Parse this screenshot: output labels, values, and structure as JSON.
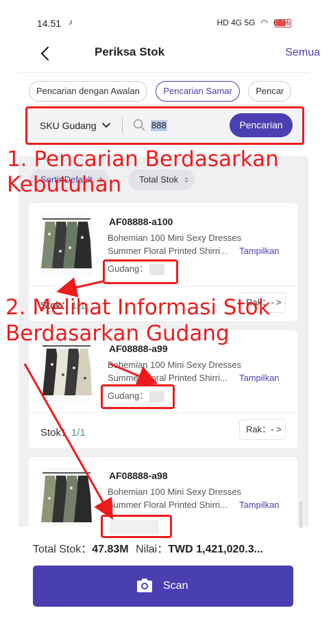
{
  "status_bar": {
    "time": "14.51",
    "network": "HD 4G 5G",
    "battery": "63%",
    "battery_level": 0.63
  },
  "header": {
    "title": "Periksa Stok",
    "right_link": "Semua"
  },
  "search_modes": [
    {
      "label": "Pencarian dengan Awalan",
      "active": false
    },
    {
      "label": "Pencarian Samar",
      "active": true
    },
    {
      "label": "Pencar",
      "active": false
    }
  ],
  "search": {
    "field": "SKU Gudang",
    "value": "888",
    "button": "Pencarian"
  },
  "sort": {
    "default_label": "Sortir Default",
    "total_label": "Total Stok"
  },
  "products": [
    {
      "sku": "AF08888-a100",
      "line1": "Bohemian 100   Mini Sexy Dresses",
      "line2": "Summer Floral Printed Shirri...",
      "show": "Tampilkan",
      "gudang_label": "Gudang：",
      "stok_label": "Stok：",
      "stok_value": "1/1",
      "rak_label": "Rak：- >"
    },
    {
      "sku": "AF08888-a99",
      "line1": "Bohemian 100   Mini Sexy Dresses",
      "line2": "Summer Floral Printed Shirri...",
      "show": "Tampilkan",
      "gudang_label": "Gudang：",
      "stok_label": "Stok：",
      "stok_value": "1/1",
      "rak_label": "Rak：- >"
    },
    {
      "sku": "AF08888-a98",
      "line1": "Bohemian 100   Mini Sexy Dresses",
      "line2": "Summer Floral Printed Shirri...",
      "show": "Tampilkan"
    }
  ],
  "footer": {
    "total_label": "Total Stok：",
    "total_value": "47.83M",
    "nilai_label": "Nilai：",
    "nilai_value": "TWD 1,421,020.3...",
    "scan_label": "Scan"
  },
  "annotations": {
    "note1_line1": "1. Pencarian Berdasarkan",
    "note1_line2": "Kebutuhan",
    "note2_line1": "2. Melihat Informasi Stok",
    "note2_line2": "Berdasarkan Gudang",
    "color": "#ee1b1b"
  },
  "colors": {
    "accent": "#4a3fb0",
    "stok_green": "#5a9e6f"
  }
}
